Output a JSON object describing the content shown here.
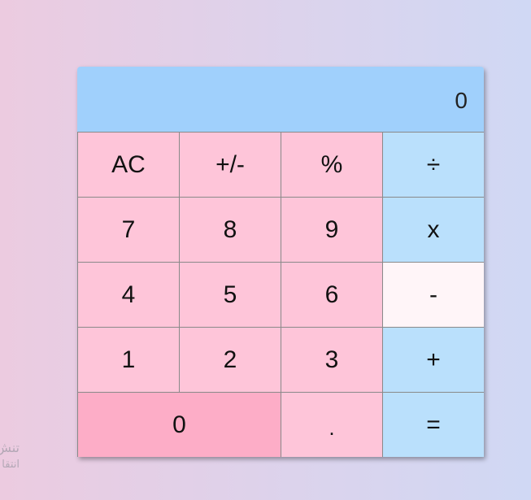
{
  "display": {
    "value": "0"
  },
  "keys": [
    {
      "label": "AC",
      "type": "num"
    },
    {
      "label": "+/-",
      "type": "num"
    },
    {
      "label": "%",
      "type": "num"
    },
    {
      "label": "÷",
      "type": "op"
    },
    {
      "label": "7",
      "type": "num"
    },
    {
      "label": "8",
      "type": "num"
    },
    {
      "label": "9",
      "type": "num"
    },
    {
      "label": "x",
      "type": "op"
    },
    {
      "label": "4",
      "type": "num"
    },
    {
      "label": "5",
      "type": "num"
    },
    {
      "label": "6",
      "type": "num"
    },
    {
      "label": "-",
      "type": "op-active"
    },
    {
      "label": "1",
      "type": "num"
    },
    {
      "label": "2",
      "type": "num"
    },
    {
      "label": "3",
      "type": "num"
    },
    {
      "label": "+",
      "type": "op"
    },
    {
      "label": "0",
      "type": "zero"
    },
    {
      "label": ".",
      "type": "dot"
    },
    {
      "label": "=",
      "type": "op"
    }
  ],
  "corner_text": {
    "line1": "تنش",
    "line2": "انتقا"
  },
  "colors": {
    "display_bg": "#a0d0fc",
    "number_key": "#fec5d9",
    "operator_key": "#bae0fc",
    "active_operator_key": "#fff5f8",
    "zero_key": "#fdadc7"
  }
}
